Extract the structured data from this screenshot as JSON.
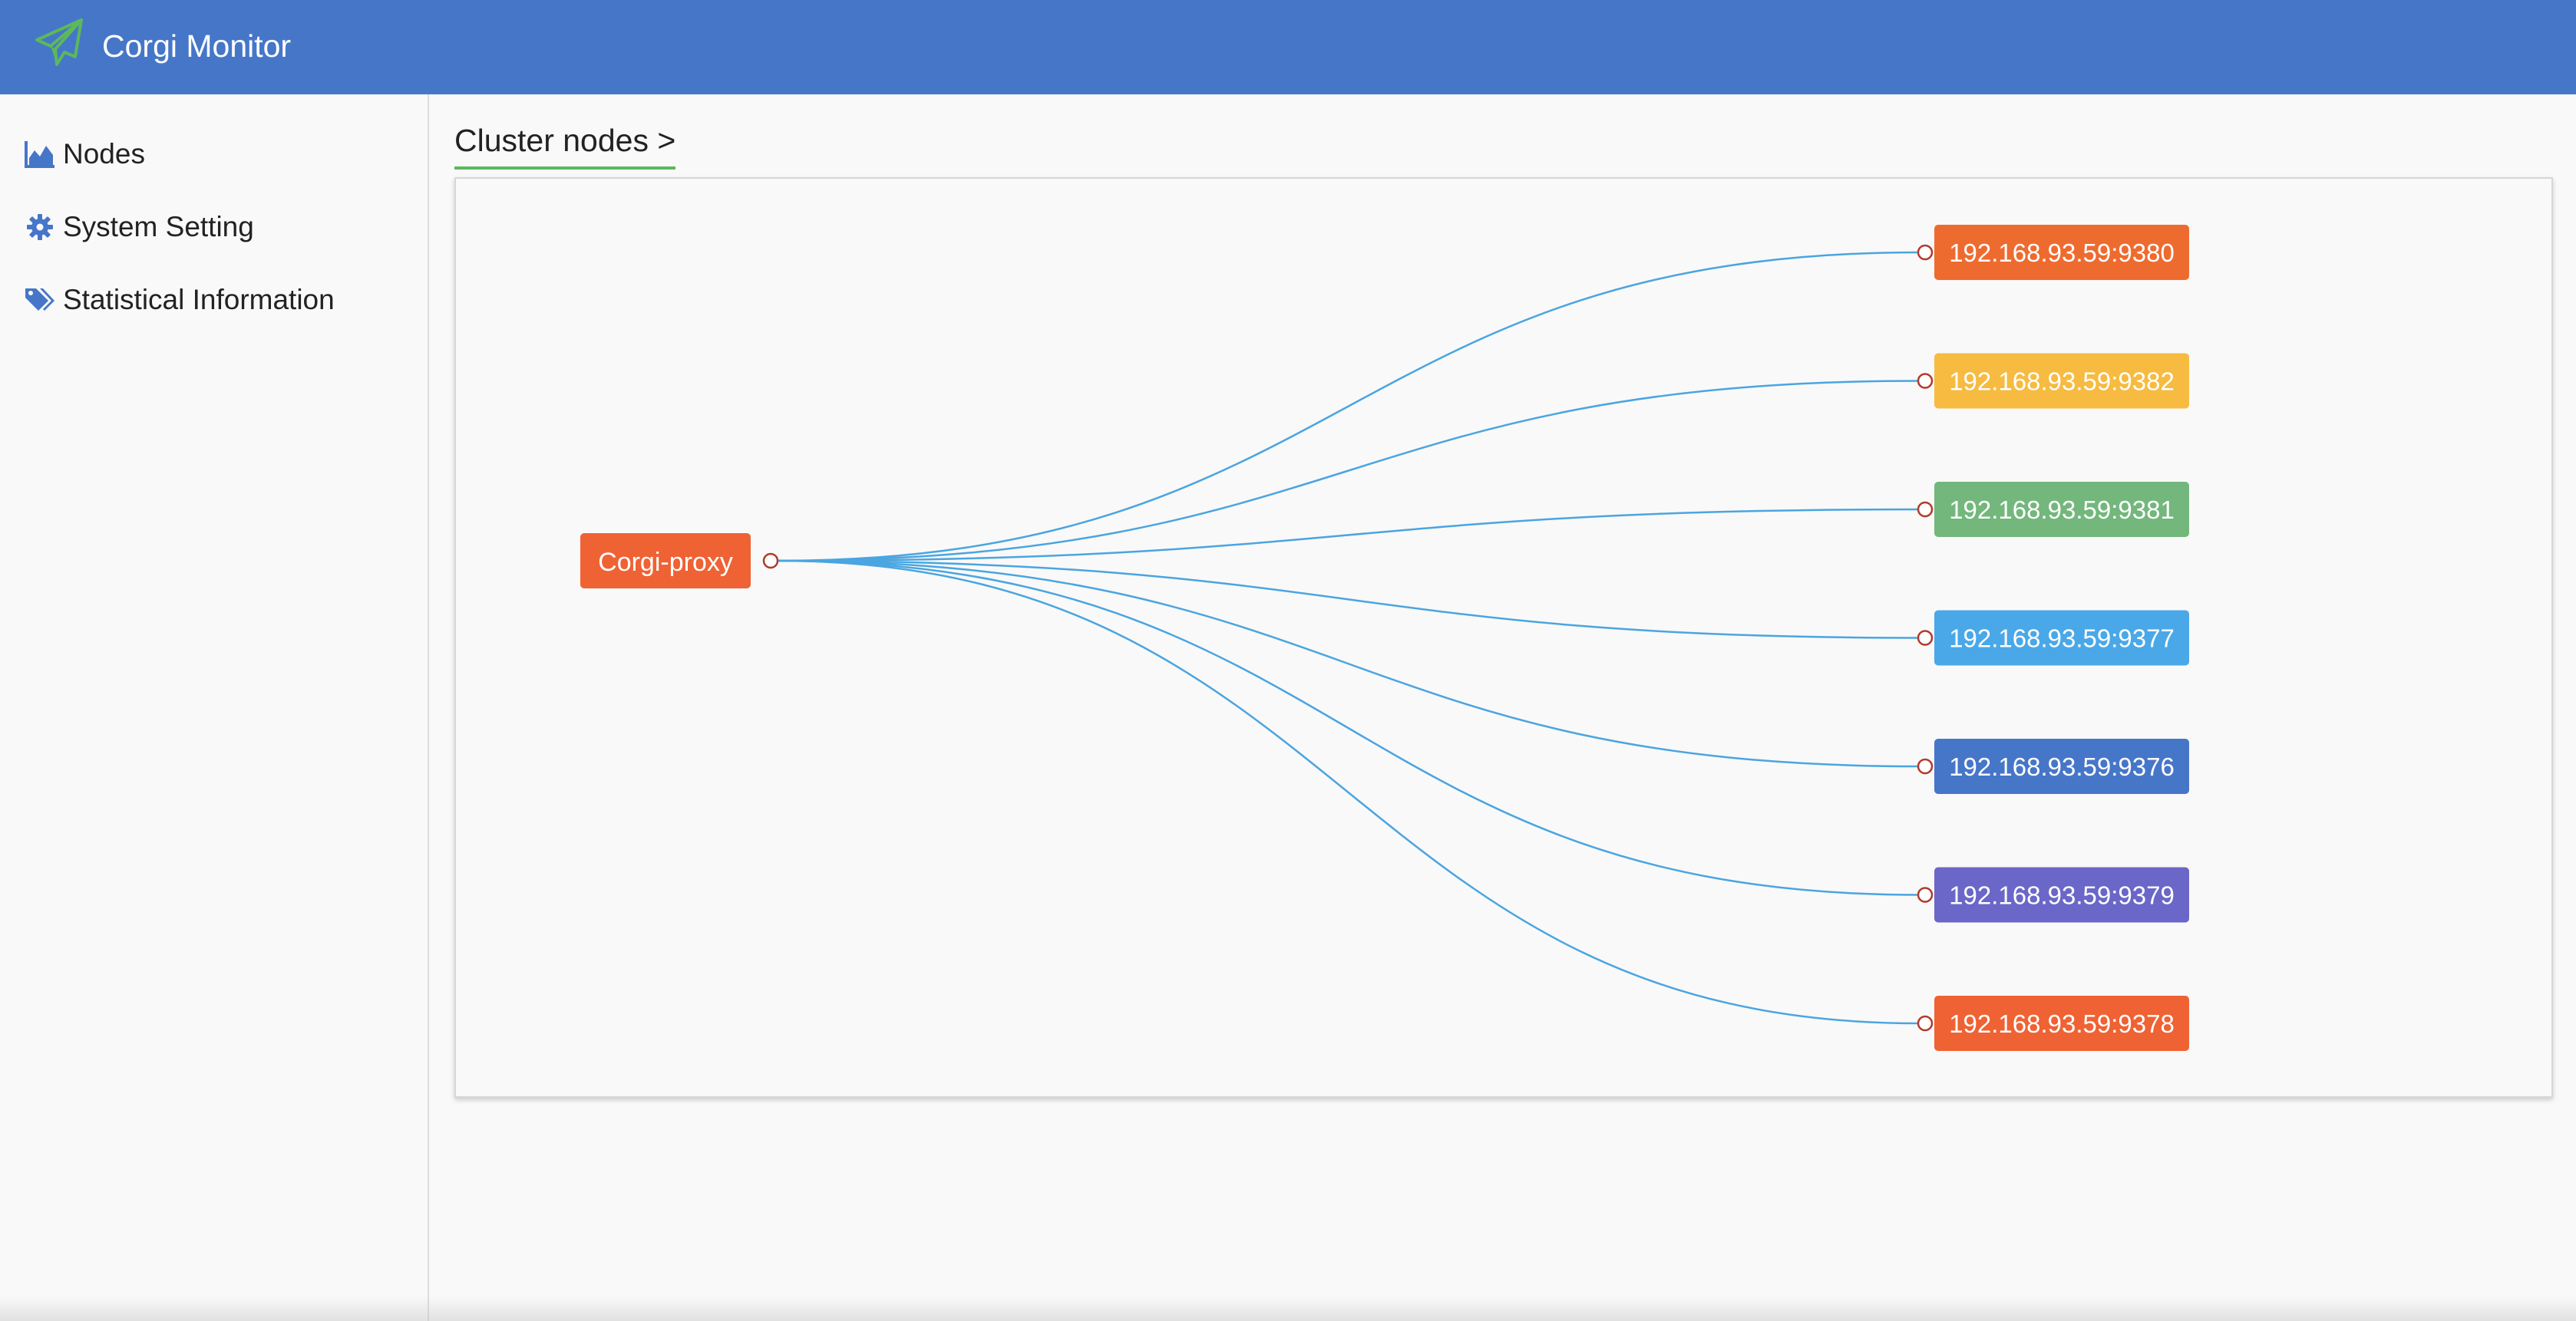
{
  "app": {
    "title": "Corgi Monitor",
    "logo_icon": "paper-plane-icon"
  },
  "colors": {
    "header": "#4676c8",
    "link_line": "#4aa5e0",
    "connector_stroke": "#b23a2a",
    "breadcrumb_underline": "#5cb85c"
  },
  "sidebar": {
    "items": [
      {
        "label": "Nodes",
        "icon": "area-chart-icon"
      },
      {
        "label": "System Setting",
        "icon": "gear-icon"
      },
      {
        "label": "Statistical Information",
        "icon": "tags-icon"
      }
    ]
  },
  "breadcrumb": {
    "label": "Cluster nodes >"
  },
  "graph": {
    "root": {
      "label": "Corgi-proxy",
      "color": "#ef6234"
    },
    "children": [
      {
        "label": "192.168.93.59:9380",
        "color": "#ee6b2f"
      },
      {
        "label": "192.168.93.59:9382",
        "color": "#f6bb40"
      },
      {
        "label": "192.168.93.59:9381",
        "color": "#73b77c"
      },
      {
        "label": "192.168.93.59:9377",
        "color": "#4aa8e8"
      },
      {
        "label": "192.168.93.59:9376",
        "color": "#4676c8"
      },
      {
        "label": "192.168.93.59:9379",
        "color": "#6b67c8"
      },
      {
        "label": "192.168.93.59:9378",
        "color": "#ef6234"
      }
    ]
  }
}
